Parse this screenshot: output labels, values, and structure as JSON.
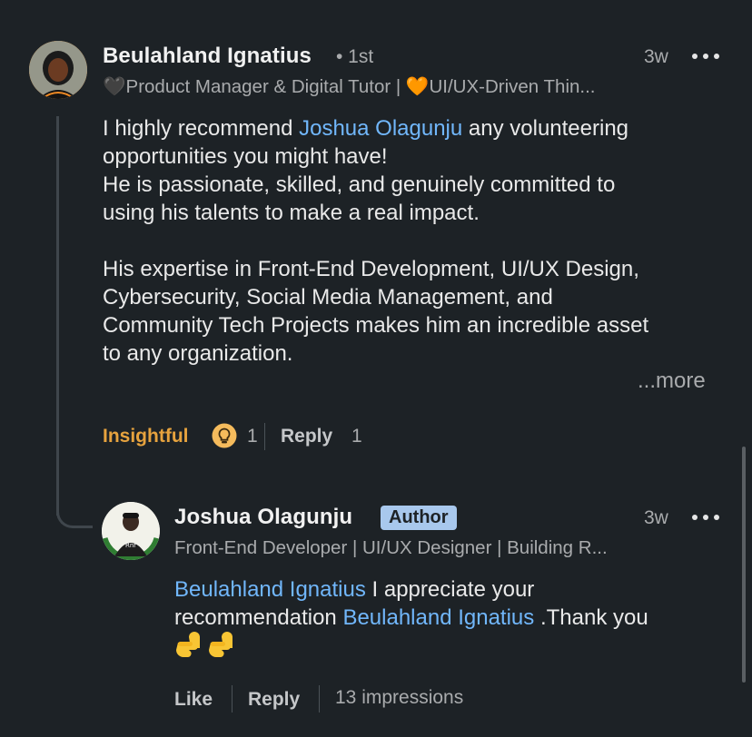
{
  "comment": {
    "author": "Beulahland Ignatius",
    "degree": "• 1st",
    "headline": "🖤Product Manager & Digital Tutor | 🧡UI/UX-Driven Thin...",
    "time": "3w",
    "body": {
      "line1_pre": "I highly recommend ",
      "line1_mention": "Joshua Olagunju",
      "line1_post": "  any volunteering",
      "line2": "opportunities you might have!",
      "line3": "He is passionate, skilled, and genuinely committed to",
      "line4": "using his talents to make a real impact.",
      "line5": "His expertise in Front-End Development, UI/UX Design,",
      "line6": "Cybersecurity, Social Media Management, and",
      "line7": "Community Tech Projects makes him an incredible asset",
      "line8": "to any organization."
    },
    "more_label": "...more",
    "reaction_label": "Insightful",
    "reaction_count": "1",
    "reply_label": "Reply",
    "reply_count": "1"
  },
  "reply": {
    "author": "Joshua Olagunju",
    "badge": "Author",
    "headline": "Front-End Developer | UI/UX Designer | Building R...",
    "time": "3w",
    "body": {
      "mention1": "Beulahland Ignatius",
      "text1": " I appreciate your",
      "text2": "recommendation ",
      "mention2": "Beulahland Ignatius",
      "text3": " .Thank you"
    },
    "like_label": "Like",
    "reply_label": "Reply",
    "impressions": "13 impressions"
  },
  "icons": {
    "menu": "more-dots-icon",
    "reaction": "lightbulb-icon",
    "emoji": "pointing-hand-emoji"
  },
  "colors": {
    "background": "#1d2226",
    "mention": "#71b7fb",
    "insightful": "#e7a33e",
    "badge": "#a8c8ed"
  }
}
